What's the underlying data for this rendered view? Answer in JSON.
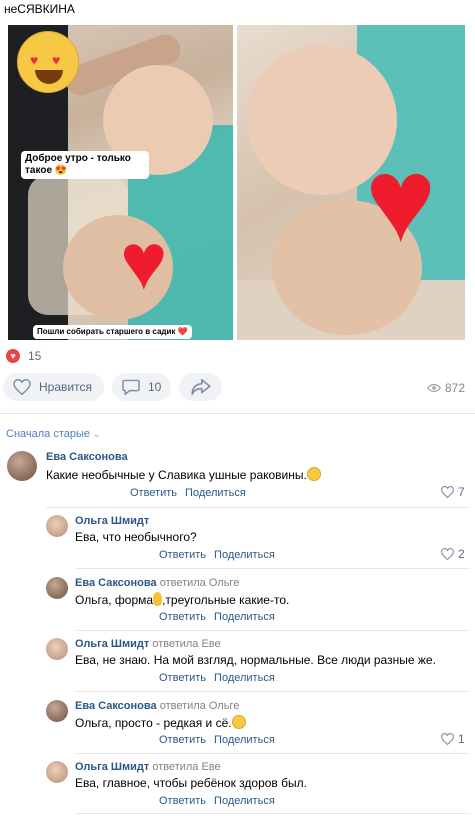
{
  "post": {
    "title": "неСЯВКИНА",
    "caption_top": "Доброе утро - только такое 😍",
    "caption_bottom": "Пошли собирать старшего в садик ❤️"
  },
  "stats": {
    "likes": "15",
    "like_label": "Нравится",
    "comments": "10",
    "views": "872"
  },
  "sort_label": "Сначала старые",
  "comments": [
    {
      "author": "Ева Саксонова",
      "reply_to": "",
      "text": "Какие необычные у Славика ушные раковины.",
      "reply_label": "Ответить",
      "share_label": "Поделиться",
      "likes": "7"
    },
    {
      "author": "Ольга Шмидт",
      "reply_to": "",
      "text": "Ева, что необычного?",
      "reply_label": "Ответить",
      "share_label": "Поделиться",
      "likes": "2"
    },
    {
      "author": "Ева Саксонова",
      "reply_to": "ответила Ольге",
      "text_before": "Ольга, форма",
      "text_after": ",треугольные какие-то.",
      "reply_label": "Ответить",
      "share_label": "Поделиться",
      "likes": ""
    },
    {
      "author": "Ольга Шмидт",
      "reply_to": "ответила Еве",
      "text": "Ева, не знаю. На мой взгляд, нормальные. Все люди разные же.",
      "reply_label": "Ответить",
      "share_label": "Поделиться",
      "likes": ""
    },
    {
      "author": "Ева Саксонова",
      "reply_to": "ответила Ольге",
      "text": "Ольга, просто - редкая и сё.",
      "reply_label": "Ответить",
      "share_label": "Поделиться",
      "likes": "1"
    },
    {
      "author": "Ольга Шмидт",
      "reply_to": "ответила Еве",
      "text": "Ева, главное, чтобы ребёнок здоров был.",
      "reply_label": "Ответить",
      "share_label": "Поделиться",
      "likes": ""
    }
  ],
  "colors": {
    "accent": "#2a5885",
    "like_red": "#e64646",
    "action_bg": "#f0f2f5"
  },
  "icons": [
    "heart-icon",
    "comment-icon",
    "share-icon",
    "eye-icon",
    "chevron-down-icon"
  ]
}
